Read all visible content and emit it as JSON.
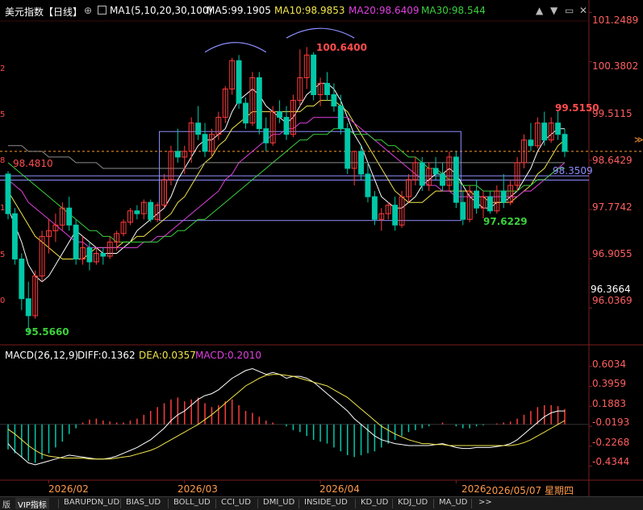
{
  "header": {
    "title": "美元指数【日线】",
    "plus_icon": "⊕",
    "ma_label": "MA1(5,10,20,30,100)",
    "ma5": "MA5:99.1905",
    "ma10": "MA10:98.9853",
    "ma20": "MA20:98.6409",
    "ma30": "MA30:98.544"
  },
  "colors": {
    "up": "#ff3b3b",
    "down": "#00c8a8",
    "ma5": "#ffffff",
    "ma10": "#f2e64b",
    "ma20": "#e040e0",
    "ma30": "#3bd13b",
    "ma100": "#8d8d8d",
    "box": "#8e8eff",
    "dash": "#ff9b2f"
  },
  "price_axis": [
    "101.2489",
    "100.3802",
    "99.5115",
    "98.6429",
    "97.7742",
    "96.9055",
    "96.0369"
  ],
  "price_annotations": {
    "high": "100.6400",
    "low": "95.5660",
    "recent_high": "99.5150",
    "recent_low": "97.6229",
    "left_level": "98.4810",
    "right_level": "98.3509",
    "current": "96.3664"
  },
  "left_ticks": [
    "2",
    "5",
    "8",
    "1",
    "5",
    "0"
  ],
  "macd": {
    "label": "MACD(26,12,9)",
    "diff": "DIFF:0.1362",
    "dea": "DEA:0.0357",
    "macd": "MACD:0.2010",
    "axis": [
      "0.6034",
      "0.3959",
      "0.1883",
      "-0.0193",
      "-0.2268",
      "-0.4344"
    ]
  },
  "time_axis": [
    "2026/02",
    "2026/03",
    "2026/04",
    "2026",
    "2026/05/07 星期四"
  ],
  "tabs": [
    {
      "label": "版"
    },
    {
      "label": "VIP指标"
    },
    {
      "label": "BARUPDN_UD"
    },
    {
      "label": "BIAS_UD"
    },
    {
      "label": "BOLL_UD"
    },
    {
      "label": "CCI_UD"
    },
    {
      "label": "DMI_UD"
    },
    {
      "label": "INSIDE_UD"
    },
    {
      "label": "KD_UD"
    },
    {
      "label": "KDJ_UD"
    },
    {
      "label": "MA_UD"
    },
    {
      "label": ">>"
    }
  ],
  "chart_data": {
    "type": "candlestick",
    "title": "美元指数【日线】",
    "y_range": [
      95.5,
      101.3
    ],
    "candles": [
      [
        98.4,
        98.45,
        97.6,
        97.7
      ],
      [
        97.7,
        97.8,
        96.8,
        96.9
      ],
      [
        96.9,
        97.0,
        96.0,
        96.2
      ],
      [
        96.2,
        96.5,
        95.57,
        95.9
      ],
      [
        95.9,
        96.7,
        95.85,
        96.6
      ],
      [
        96.6,
        97.4,
        96.5,
        97.3
      ],
      [
        97.3,
        97.6,
        97.0,
        97.4
      ],
      [
        97.4,
        97.7,
        97.2,
        97.5
      ],
      [
        97.5,
        97.9,
        97.4,
        97.8
      ],
      [
        97.8,
        98.0,
        97.4,
        97.5
      ],
      [
        97.5,
        97.6,
        96.8,
        96.9
      ],
      [
        96.9,
        97.3,
        96.8,
        97.1
      ],
      [
        97.1,
        97.2,
        96.7,
        96.85
      ],
      [
        96.85,
        97.1,
        96.8,
        97.0
      ],
      [
        97.0,
        97.1,
        96.8,
        96.95
      ],
      [
        96.95,
        97.3,
        96.9,
        97.2
      ],
      [
        97.2,
        97.4,
        97.05,
        97.35
      ],
      [
        97.35,
        97.6,
        97.3,
        97.55
      ],
      [
        97.55,
        97.8,
        97.5,
        97.75
      ],
      [
        97.75,
        97.85,
        97.6,
        97.7
      ],
      [
        97.7,
        97.95,
        97.6,
        97.9
      ],
      [
        97.9,
        97.95,
        97.55,
        97.6
      ],
      [
        97.6,
        97.9,
        97.55,
        97.85
      ],
      [
        97.85,
        98.4,
        97.8,
        98.3
      ],
      [
        98.3,
        98.9,
        98.2,
        98.8
      ],
      [
        98.8,
        99.2,
        98.6,
        98.7
      ],
      [
        98.7,
        98.9,
        98.4,
        98.8
      ],
      [
        98.8,
        99.4,
        98.6,
        99.3
      ],
      [
        99.3,
        99.6,
        99.0,
        99.1
      ],
      [
        99.1,
        99.3,
        98.7,
        98.8
      ],
      [
        98.8,
        99.2,
        98.7,
        99.1
      ],
      [
        99.1,
        99.5,
        99.0,
        99.4
      ],
      [
        99.4,
        99.95,
        99.3,
        99.9
      ],
      [
        99.9,
        100.45,
        99.8,
        100.4
      ],
      [
        100.4,
        100.5,
        99.55,
        99.65
      ],
      [
        99.65,
        99.75,
        99.2,
        99.3
      ],
      [
        99.3,
        100.2,
        99.25,
        100.1
      ],
      [
        100.1,
        100.2,
        99.1,
        99.2
      ],
      [
        99.2,
        99.4,
        98.8,
        98.95
      ],
      [
        98.95,
        99.6,
        98.9,
        99.5
      ],
      [
        99.5,
        99.7,
        99.3,
        99.4
      ],
      [
        99.4,
        99.6,
        99.0,
        99.1
      ],
      [
        99.1,
        99.8,
        99.05,
        99.7
      ],
      [
        99.7,
        100.6,
        99.6,
        100.1
      ],
      [
        100.1,
        100.64,
        99.9,
        100.5
      ],
      [
        100.5,
        100.55,
        99.7,
        99.8
      ],
      [
        99.8,
        100.1,
        99.6,
        100.0
      ],
      [
        100.0,
        100.2,
        99.7,
        99.8
      ],
      [
        99.8,
        100.0,
        99.5,
        99.6
      ],
      [
        99.6,
        99.8,
        99.1,
        99.2
      ],
      [
        99.2,
        99.3,
        98.4,
        98.5
      ],
      [
        98.5,
        98.8,
        98.2,
        98.8
      ],
      [
        98.8,
        98.9,
        98.3,
        98.4
      ],
      [
        98.4,
        98.6,
        97.9,
        98.0
      ],
      [
        98.0,
        98.1,
        97.5,
        97.6
      ],
      [
        97.6,
        97.8,
        97.4,
        97.7
      ],
      [
        97.7,
        97.9,
        97.6,
        97.85
      ],
      [
        97.85,
        98.0,
        97.4,
        97.5
      ],
      [
        97.5,
        98.1,
        97.45,
        98.0
      ],
      [
        98.0,
        98.4,
        97.9,
        98.3
      ],
      [
        98.3,
        98.7,
        98.2,
        98.6
      ],
      [
        98.6,
        98.7,
        98.1,
        98.2
      ],
      [
        98.2,
        98.6,
        98.1,
        98.5
      ],
      [
        98.5,
        98.7,
        98.3,
        98.4
      ],
      [
        98.4,
        98.6,
        98.1,
        98.2
      ],
      [
        98.2,
        98.8,
        98.1,
        98.7
      ],
      [
        98.7,
        98.8,
        97.8,
        97.9
      ],
      [
        97.9,
        98.1,
        97.5,
        97.6
      ],
      [
        97.6,
        98.2,
        97.55,
        98.1
      ],
      [
        98.1,
        98.3,
        97.7,
        97.8
      ],
      [
        97.8,
        98.1,
        97.62,
        98.0
      ],
      [
        98.0,
        98.1,
        97.7,
        97.75
      ],
      [
        97.75,
        98.2,
        97.7,
        98.1
      ],
      [
        98.1,
        98.4,
        97.8,
        97.9
      ],
      [
        97.9,
        98.3,
        97.85,
        98.2
      ],
      [
        98.2,
        98.7,
        98.1,
        98.6
      ],
      [
        98.6,
        99.1,
        98.5,
        99.0
      ],
      [
        99.0,
        99.3,
        98.8,
        98.9
      ],
      [
        98.9,
        99.4,
        98.85,
        99.3
      ],
      [
        99.3,
        99.5,
        98.9,
        99.0
      ],
      [
        99.0,
        99.4,
        98.95,
        99.3
      ],
      [
        99.3,
        99.515,
        99.0,
        99.1
      ],
      [
        99.1,
        99.2,
        98.7,
        98.8
      ]
    ],
    "ma_series": [
      {
        "name": "MA5",
        "values": [
          97.8,
          97.5,
          97.2,
          96.8,
          96.6,
          96.5,
          96.6,
          96.8,
          97.0,
          97.2,
          97.4,
          97.3,
          97.2,
          97.1,
          97.0,
          97.0,
          97.0,
          97.1,
          97.2,
          97.4,
          97.5,
          97.6,
          97.7,
          97.8,
          98.0,
          98.3,
          98.5,
          98.7,
          98.9,
          99.0,
          99.0,
          99.1,
          99.2,
          99.5,
          99.7,
          99.8,
          99.9,
          99.8,
          99.6,
          99.5,
          99.4,
          99.3,
          99.4,
          99.6,
          99.8,
          99.9,
          100.0,
          100.0,
          99.9,
          99.7,
          99.4,
          99.1,
          98.9,
          98.6,
          98.3,
          98.0,
          97.9,
          97.8,
          97.8,
          97.9,
          98.0,
          98.2,
          98.3,
          98.4,
          98.4,
          98.5,
          98.4,
          98.2,
          98.0,
          97.9,
          97.8,
          97.8,
          97.9,
          97.9,
          98.0,
          98.1,
          98.3,
          98.5,
          98.8,
          99.0,
          99.1,
          99.2,
          99.2
        ]
      },
      {
        "name": "MA10",
        "values": [
          98.1,
          97.9,
          97.7,
          97.5,
          97.3,
          97.2,
          97.1,
          97.0,
          96.9,
          96.9,
          96.9,
          96.9,
          97.0,
          97.1,
          97.1,
          97.1,
          97.1,
          97.2,
          97.2,
          97.3,
          97.3,
          97.4,
          97.5,
          97.6,
          97.7,
          97.9,
          98.0,
          98.2,
          98.4,
          98.6,
          98.7,
          98.9,
          99.0,
          99.2,
          99.3,
          99.4,
          99.5,
          99.5,
          99.5,
          99.5,
          99.5,
          99.5,
          99.5,
          99.5,
          99.6,
          99.6,
          99.7,
          99.7,
          99.7,
          99.6,
          99.5,
          99.3,
          99.1,
          98.9,
          98.7,
          98.5,
          98.3,
          98.1,
          98.0,
          97.9,
          97.9,
          97.9,
          98.0,
          98.1,
          98.1,
          98.1,
          98.1,
          98.1,
          98.1,
          98.0,
          98.0,
          97.9,
          97.9,
          97.9,
          97.9,
          98.0,
          98.1,
          98.2,
          98.4,
          98.5,
          98.7,
          98.9,
          99.0
        ]
      },
      {
        "name": "MA20",
        "values": [
          98.3,
          98.2,
          98.1,
          97.9,
          97.8,
          97.7,
          97.6,
          97.5,
          97.4,
          97.3,
          97.2,
          97.2,
          97.1,
          97.1,
          97.1,
          97.1,
          97.1,
          97.1,
          97.1,
          97.1,
          97.2,
          97.2,
          97.3,
          97.3,
          97.4,
          97.5,
          97.6,
          97.7,
          97.8,
          97.9,
          98.0,
          98.1,
          98.3,
          98.4,
          98.6,
          98.7,
          98.8,
          98.9,
          99.0,
          99.1,
          99.1,
          99.2,
          99.2,
          99.3,
          99.3,
          99.4,
          99.4,
          99.4,
          99.4,
          99.4,
          99.4,
          99.3,
          99.2,
          99.1,
          99.0,
          98.9,
          98.8,
          98.7,
          98.6,
          98.5,
          98.4,
          98.3,
          98.2,
          98.2,
          98.1,
          98.1,
          98.0,
          98.0,
          98.0,
          98.0,
          98.0,
          98.0,
          98.0,
          98.0,
          98.0,
          98.0,
          98.1,
          98.1,
          98.2,
          98.3,
          98.4,
          98.5,
          98.6
        ]
      },
      {
        "name": "MA30",
        "values": [
          98.6,
          98.5,
          98.4,
          98.3,
          98.2,
          98.1,
          98.0,
          97.9,
          97.8,
          97.7,
          97.6,
          97.5,
          97.4,
          97.4,
          97.3,
          97.3,
          97.2,
          97.2,
          97.2,
          97.2,
          97.2,
          97.2,
          97.2,
          97.3,
          97.3,
          97.4,
          97.4,
          97.5,
          97.6,
          97.6,
          97.7,
          97.8,
          97.9,
          98.0,
          98.1,
          98.2,
          98.3,
          98.4,
          98.5,
          98.6,
          98.7,
          98.8,
          98.9,
          99.0,
          99.0,
          99.1,
          99.1,
          99.1,
          99.2,
          99.2,
          99.2,
          99.1,
          99.1,
          99.1,
          99.0,
          99.0,
          98.9,
          98.9,
          98.8,
          98.7,
          98.7,
          98.6,
          98.5,
          98.5,
          98.4,
          98.3,
          98.3,
          98.2,
          98.2,
          98.2,
          98.1,
          98.1,
          98.1,
          98.1,
          98.1,
          98.1,
          98.2,
          98.2,
          98.3,
          98.3,
          98.4,
          98.5,
          98.5
        ]
      },
      {
        "name": "MA100",
        "values": [
          98.9,
          98.9,
          98.9,
          98.8,
          98.8,
          98.8,
          98.7,
          98.7,
          98.7,
          98.7,
          98.6,
          98.6,
          98.6,
          98.6,
          98.5,
          98.5,
          98.5,
          98.5,
          98.5,
          98.5,
          98.5,
          98.5,
          98.5,
          98.5,
          98.5,
          98.5,
          98.5,
          98.5,
          98.5,
          98.6,
          98.6,
          98.6,
          98.6,
          98.6,
          98.6,
          98.6,
          98.6,
          98.6,
          98.6,
          98.6,
          98.6,
          98.6,
          98.6,
          98.6,
          98.6,
          98.6,
          98.6,
          98.6,
          98.6,
          98.6,
          98.6,
          98.6,
          98.6,
          98.6,
          98.6,
          98.6,
          98.6,
          98.6,
          98.6,
          98.6,
          98.6,
          98.6,
          98.6,
          98.6,
          98.6,
          98.6,
          98.6,
          98.6,
          98.6,
          98.6,
          98.6,
          98.6,
          98.6,
          98.6,
          98.6,
          98.6,
          98.6,
          98.6,
          98.6,
          98.6,
          98.6,
          98.6,
          98.6
        ]
      }
    ],
    "macd_y_range": [
      -0.53,
      0.66
    ],
    "macd_hist": [
      -0.26,
      -0.3,
      -0.34,
      -0.38,
      -0.4,
      -0.36,
      -0.3,
      -0.24,
      -0.18,
      -0.1,
      -0.04,
      0.02,
      0.05,
      0.06,
      0.04,
      0.03,
      0.02,
      0.02,
      0.04,
      0.06,
      0.1,
      0.14,
      0.18,
      0.22,
      0.26,
      0.28,
      0.24,
      0.26,
      0.28,
      0.22,
      0.18,
      0.2,
      0.24,
      0.26,
      0.2,
      0.14,
      0.12,
      0.08,
      0.04,
      0.02,
      0.0,
      -0.02,
      -0.06,
      -0.08,
      -0.12,
      -0.16,
      -0.18,
      -0.2,
      -0.24,
      -0.28,
      -0.32,
      -0.34,
      -0.32,
      -0.3,
      -0.28,
      -0.24,
      -0.2,
      -0.16,
      -0.12,
      -0.08,
      -0.06,
      -0.04,
      -0.02,
      0.0,
      0.02,
      0.0,
      -0.02,
      -0.04,
      -0.04,
      -0.02,
      -0.01,
      0.0,
      0.01,
      0.02,
      0.03,
      0.06,
      0.1,
      0.14,
      0.18,
      0.2,
      0.2,
      0.19,
      0.16
    ],
    "diff": [
      -0.2,
      -0.28,
      -0.34,
      -0.4,
      -0.42,
      -0.4,
      -0.38,
      -0.36,
      -0.34,
      -0.32,
      -0.33,
      -0.34,
      -0.35,
      -0.36,
      -0.36,
      -0.35,
      -0.33,
      -0.3,
      -0.27,
      -0.24,
      -0.2,
      -0.16,
      -0.1,
      -0.04,
      0.04,
      0.1,
      0.14,
      0.2,
      0.26,
      0.3,
      0.32,
      0.36,
      0.42,
      0.48,
      0.52,
      0.56,
      0.58,
      0.55,
      0.52,
      0.54,
      0.52,
      0.48,
      0.5,
      0.5,
      0.48,
      0.44,
      0.38,
      0.32,
      0.26,
      0.2,
      0.14,
      0.06,
      0.0,
      -0.06,
      -0.12,
      -0.16,
      -0.18,
      -0.2,
      -0.21,
      -0.22,
      -0.22,
      -0.22,
      -0.22,
      -0.21,
      -0.2,
      -0.22,
      -0.24,
      -0.25,
      -0.25,
      -0.24,
      -0.24,
      -0.24,
      -0.23,
      -0.22,
      -0.2,
      -0.16,
      -0.1,
      -0.04,
      0.02,
      0.08,
      0.12,
      0.14,
      0.14
    ],
    "dea": [
      -0.05,
      -0.1,
      -0.16,
      -0.22,
      -0.27,
      -0.31,
      -0.33,
      -0.34,
      -0.35,
      -0.35,
      -0.35,
      -0.35,
      -0.36,
      -0.36,
      -0.36,
      -0.36,
      -0.35,
      -0.34,
      -0.33,
      -0.31,
      -0.29,
      -0.27,
      -0.24,
      -0.2,
      -0.16,
      -0.12,
      -0.08,
      -0.04,
      0.0,
      0.05,
      0.1,
      0.16,
      0.22,
      0.28,
      0.34,
      0.4,
      0.44,
      0.48,
      0.51,
      0.52,
      0.52,
      0.51,
      0.5,
      0.48,
      0.46,
      0.44,
      0.42,
      0.4,
      0.36,
      0.32,
      0.28,
      0.22,
      0.16,
      0.1,
      0.04,
      -0.02,
      -0.06,
      -0.1,
      -0.13,
      -0.16,
      -0.18,
      -0.2,
      -0.2,
      -0.21,
      -0.21,
      -0.22,
      -0.22,
      -0.22,
      -0.22,
      -0.22,
      -0.22,
      -0.22,
      -0.22,
      -0.22,
      -0.22,
      -0.21,
      -0.19,
      -0.16,
      -0.12,
      -0.08,
      -0.04,
      0.0,
      0.04
    ]
  }
}
